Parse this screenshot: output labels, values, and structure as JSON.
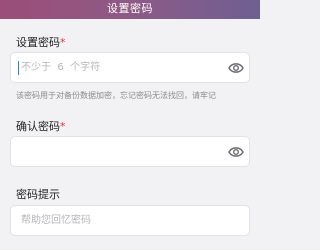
{
  "header": {
    "title": "设置密码"
  },
  "set_password": {
    "label": "设置密码",
    "required_mark": "*",
    "placeholder_prefix": "不少于",
    "placeholder_number": "6",
    "placeholder_suffix": "个字符",
    "hint": "该密码用于对备份数据加密，忘记密码无法找回，请牢记"
  },
  "confirm_password": {
    "label": "确认密码",
    "required_mark": "*"
  },
  "password_hint": {
    "label": "密码提示",
    "placeholder": "帮助您回忆密码"
  },
  "colors": {
    "required": "#e0322f",
    "header_start": "#9a4e78",
    "header_end": "#6e5f92",
    "cursor": "#2a7de1"
  },
  "icons": {
    "visibility_toggle": "eye-icon"
  }
}
